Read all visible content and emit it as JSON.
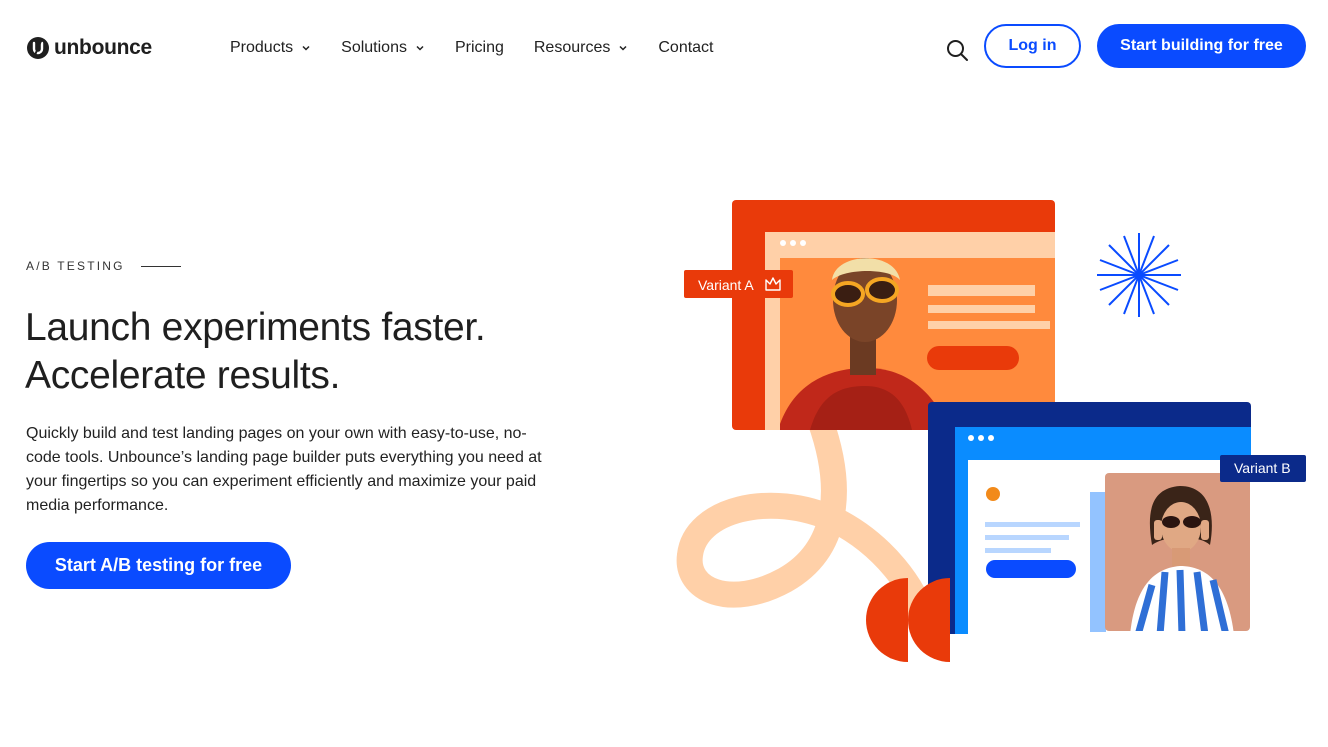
{
  "header": {
    "logo_text": "unbounce",
    "nav": [
      {
        "label": "Products",
        "has_dropdown": true
      },
      {
        "label": "Solutions",
        "has_dropdown": true
      },
      {
        "label": "Pricing",
        "has_dropdown": false
      },
      {
        "label": "Resources",
        "has_dropdown": true
      },
      {
        "label": "Contact",
        "has_dropdown": false
      }
    ],
    "login_label": "Log in",
    "start_label": "Start building for free"
  },
  "hero": {
    "eyebrow": "A/B TESTING",
    "headline_line1": "Launch experiments faster.",
    "headline_line2": "Accelerate results.",
    "description": "Quickly build and test landing pages on your own with easy-to-use, no-code tools. Unbounce’s landing page builder puts everything you need at your fingertips so you can experiment efficiently and maximize your paid media performance.",
    "cta_label": "Start A/B testing for free"
  },
  "illustration": {
    "variant_a_label": "Variant A",
    "variant_b_label": "Variant B"
  },
  "colors": {
    "brand_blue": "#0a4bff",
    "variant_a_orange": "#e93a0a",
    "variant_b_navy": "#0b2a8a",
    "peach": "#ffd0a8"
  }
}
